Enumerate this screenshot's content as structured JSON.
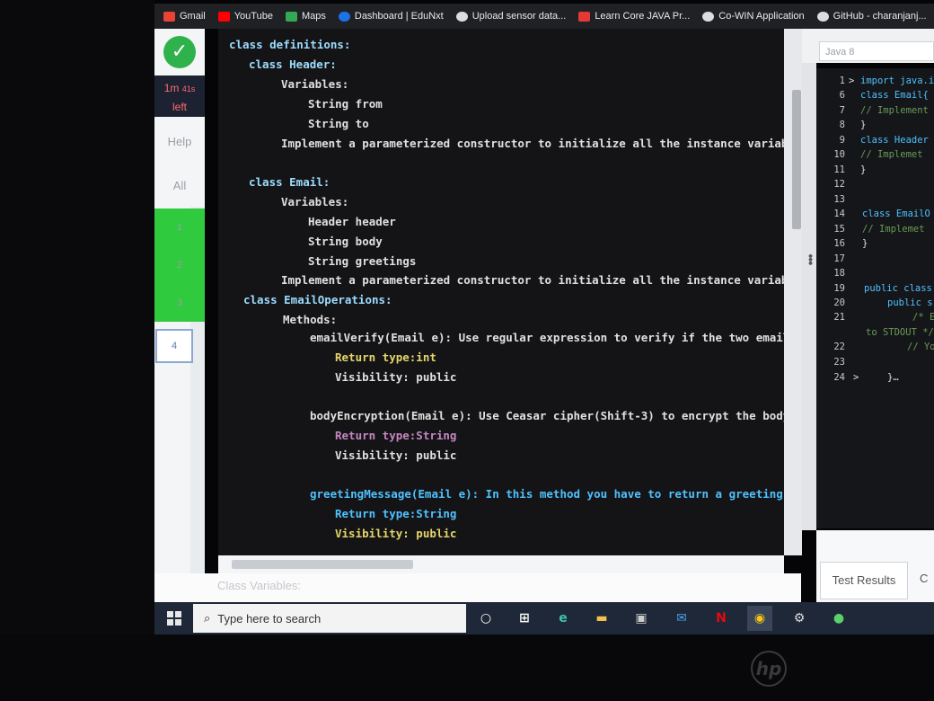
{
  "bookmarks": [
    {
      "label": "Gmail",
      "color": "#ea4335",
      "icon": "gmail-icon"
    },
    {
      "label": "YouTube",
      "color": "#ff0000",
      "icon": "youtube-icon"
    },
    {
      "label": "Maps",
      "color": "#34a853",
      "icon": "maps-icon"
    },
    {
      "label": "Dashboard | EduNxt",
      "color": "#1a73e8",
      "icon": "edunxt-icon"
    },
    {
      "label": "Upload sensor data...",
      "color": "#dddddd",
      "icon": "upload-icon"
    },
    {
      "label": "Learn Core JAVA Pr...",
      "color": "#e53935",
      "icon": "java-icon"
    },
    {
      "label": "Co-WIN Application",
      "color": "#dddddd",
      "icon": "cowin-icon"
    },
    {
      "label": "GitHub - charanjanj...",
      "color": "#dddddd",
      "icon": "github-icon"
    }
  ],
  "sidebar": {
    "timer_value": "1m",
    "timer_secs": "41s",
    "timer_left": "left",
    "help": "Help",
    "all": "All",
    "questions": [
      "1",
      "2",
      "3",
      "4"
    ]
  },
  "statement": {
    "lines": [
      "class definitions:",
      "class Header:",
      "Variables:",
      "String from",
      "String to",
      "Implement a parameterized constructor to initialize all the instance variable",
      "class Email:",
      "Variables:",
      "Header header",
      "String body",
      "String greetings",
      "Implement a parameterized constructor to initialize all the instance variable",
      "class EmailOperations:",
      "Methods:",
      "emailVerify(Email e): Use regular expression to verify if the two email-i",
      "Return type:int",
      "Visibility: public",
      "bodyEncryption(Email e): Use Ceasar cipher(Shift-3) to encrypt the body o",
      "Return type:String",
      "Visibility: public",
      "greetingMessage(Email e): In this method you have to return a greeting me",
      "Return type:String",
      "Visibility: public"
    ],
    "footer": "Class Variables:"
  },
  "editor": {
    "language": "Java 8",
    "line_numbers": [
      "1",
      "6",
      "7",
      "8",
      "9",
      "10",
      "11",
      "12",
      "13",
      "14",
      "15",
      "16",
      "17",
      "18",
      "19",
      "20",
      "21",
      "22",
      "23",
      "24"
    ],
    "code": [
      "import java.i",
      "class Email{",
      "// Implement",
      "}",
      "class Header",
      "// Implemet",
      "}",
      "class EmailO",
      "// Implemet",
      "}",
      "public class",
      "public s",
      "/* E",
      "to STDOUT */",
      "// You",
      "}…"
    ],
    "tab_results": "Test Results",
    "tab_next": "C"
  },
  "taskbar": {
    "search_placeholder": "Type here to search"
  },
  "brand": "hp"
}
